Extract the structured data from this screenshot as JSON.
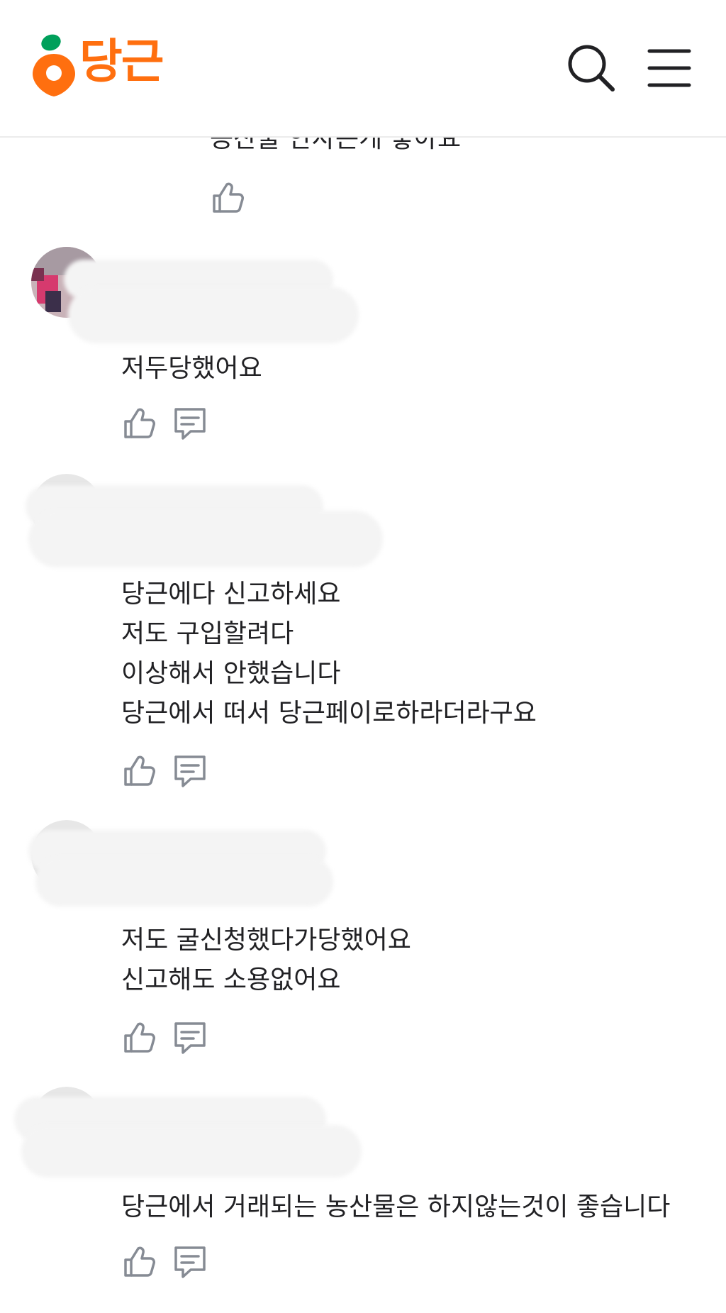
{
  "app": {
    "logo_text": "당근",
    "brand_color": "#ff6f0f",
    "icons": {
      "search": "search-icon",
      "menu": "hamburger-menu-icon"
    }
  },
  "previous_comment": {
    "text_partial": "농산물 안사는게 좋아요"
  },
  "comments": [
    {
      "text_lines": [
        "저두당했어요"
      ]
    },
    {
      "text_lines": [
        "당근에다 신고하세요",
        "저도 구입할려다",
        "이상해서 안했습니다",
        "당근에서 떠서 당근페이로하라더라구요"
      ]
    },
    {
      "text_lines": [
        "저도 굴신청했다가당했어요",
        "신고해도 소용없어요"
      ]
    },
    {
      "text_lines": [
        "당근에서 거래되는 농산물은 하지않는것이 좋습니다"
      ]
    }
  ]
}
